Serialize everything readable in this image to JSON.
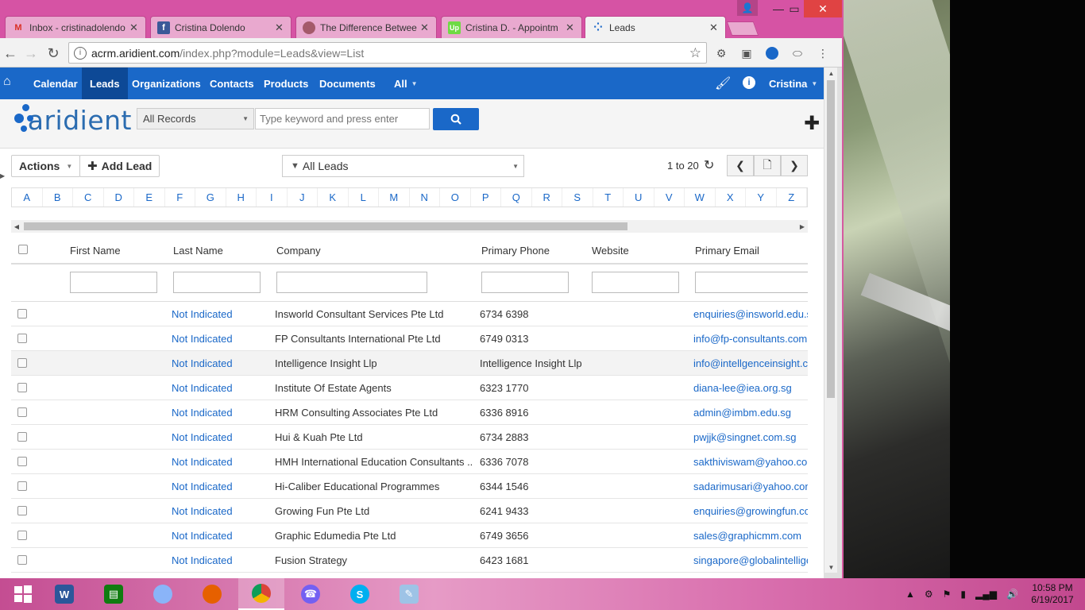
{
  "browser": {
    "tabs": [
      {
        "title": "Inbox - cristinadolendo",
        "icon": "gmail-icon"
      },
      {
        "title": "Cristina Dolendo",
        "icon": "facebook-icon"
      },
      {
        "title": "The Difference Betwee",
        "icon": "avatar-icon"
      },
      {
        "title": "Cristina D. - Appointm",
        "icon": "upwork-icon"
      },
      {
        "title": "Leads",
        "icon": "aridient-icon"
      }
    ],
    "url_host": "acrm.aridient.com",
    "url_path": "/index.php?module=Leads&view=List"
  },
  "crm": {
    "nav": {
      "items": [
        "Calendar",
        "Leads",
        "Organizations",
        "Contacts",
        "Products",
        "Documents",
        "All"
      ],
      "active": "Leads",
      "user": "Cristina"
    },
    "logo_text": "aridient",
    "search": {
      "scope": "All Records",
      "placeholder": "Type keyword and press enter"
    },
    "actions_label": "Actions",
    "add_lead_label": "Add Lead",
    "filter_label": "All Leads",
    "paging": "1 to 20",
    "alphabet": [
      "A",
      "B",
      "C",
      "D",
      "E",
      "F",
      "G",
      "H",
      "I",
      "J",
      "K",
      "L",
      "M",
      "N",
      "O",
      "P",
      "Q",
      "R",
      "S",
      "T",
      "U",
      "V",
      "W",
      "X",
      "Y",
      "Z"
    ],
    "columns": [
      "First Name",
      "Last Name",
      "Company",
      "Primary Phone",
      "Website",
      "Primary Email"
    ],
    "rows": [
      {
        "first": "",
        "last": "Not Indicated",
        "company": "Insworld Consultant Services Pte Ltd",
        "phone": "6734 6398",
        "website": "",
        "email": "enquiries@insworld.edu.s"
      },
      {
        "first": "",
        "last": "Not Indicated",
        "company": "FP Consultants International Pte Ltd",
        "phone": "6749 0313",
        "website": "",
        "email": "info@fp-consultants.com"
      },
      {
        "first": "",
        "last": "Not Indicated",
        "company": "Intelligence Insight Llp",
        "phone": "Intelligence Insight Llp",
        "website": "",
        "email": "info@intellgenceinsight.co"
      },
      {
        "first": "",
        "last": "Not Indicated",
        "company": "Institute Of Estate Agents",
        "phone": "6323 1770",
        "website": "",
        "email": "diana-lee@iea.org.sg"
      },
      {
        "first": "",
        "last": "Not Indicated",
        "company": "HRM Consulting Associates Pte Ltd",
        "phone": "6336 8916",
        "website": "",
        "email": "admin@imbm.edu.sg"
      },
      {
        "first": "",
        "last": "Not Indicated",
        "company": "Hui & Kuah Pte Ltd",
        "phone": "6734 2883",
        "website": "",
        "email": "pwjjk@singnet.com.sg"
      },
      {
        "first": "",
        "last": "Not Indicated",
        "company": "HMH International Education Consultants ...",
        "phone": "6336 7078",
        "website": "",
        "email": "sakthiviswam@yahoo.com"
      },
      {
        "first": "",
        "last": "Not Indicated",
        "company": "Hi-Caliber Educational Programmes",
        "phone": "6344 1546",
        "website": "",
        "email": "sadarimusari@yahoo.com"
      },
      {
        "first": "",
        "last": "Not Indicated",
        "company": "Growing Fun Pte Ltd",
        "phone": "6241 9433",
        "website": "",
        "email": "enquiries@growingfun.co"
      },
      {
        "first": "",
        "last": "Not Indicated",
        "company": "Graphic Edumedia Pte Ltd",
        "phone": "6749 3656",
        "website": "",
        "email": "sales@graphicmm.com"
      },
      {
        "first": "",
        "last": "Not Indicated",
        "company": "Fusion Strategy",
        "phone": "6423 1681",
        "website": "",
        "email": "singapore@globalintellige"
      }
    ]
  },
  "taskbar": {
    "time": "10:58 PM",
    "date": "6/19/2017"
  }
}
